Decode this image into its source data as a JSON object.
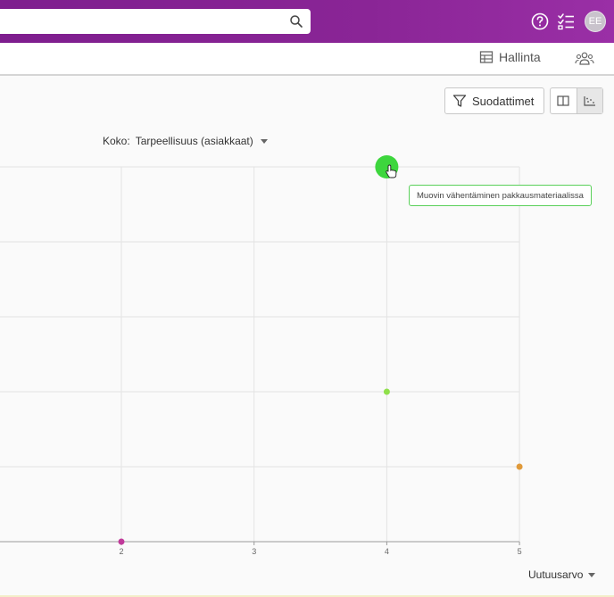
{
  "topbar": {
    "search": {
      "value": "",
      "placeholder": ""
    },
    "avatar_initials": "EE",
    "icons": [
      "search-icon",
      "help-icon",
      "checklist-icon"
    ],
    "colors": {
      "brand": "#8a2596"
    }
  },
  "subbar": {
    "admin_label": "Hallinta",
    "icons": [
      "admin-table-icon",
      "people-icon"
    ]
  },
  "toolbar": {
    "filters_label": "Suodattimet",
    "view_modes": [
      "columns-view",
      "scatter-view"
    ],
    "active_view": "scatter-view"
  },
  "controls": {
    "size_label": "Koko:",
    "size_value": "Tarpeellisuus (asiakkaat)",
    "x_axis_value": "Uutuusarvo"
  },
  "tooltip": {
    "text": "Muovin vähentäminen pakkausmateriaalissa"
  },
  "chart_data": {
    "type": "scatter",
    "x_ticks": [
      "2",
      "3",
      "4",
      "5"
    ],
    "xlim": [
      1,
      5
    ],
    "ylim": [
      0,
      5
    ],
    "grid": true,
    "points": [
      {
        "x": 2,
        "y": 0,
        "color": "#c0399a"
      },
      {
        "x": 4,
        "y": 2,
        "color": "#8fe04a"
      },
      {
        "x": 5,
        "y": 1,
        "color": "#e09a3a"
      },
      {
        "x": 4,
        "y": 5,
        "color": "#3dd63d",
        "highlighted": true
      }
    ]
  }
}
